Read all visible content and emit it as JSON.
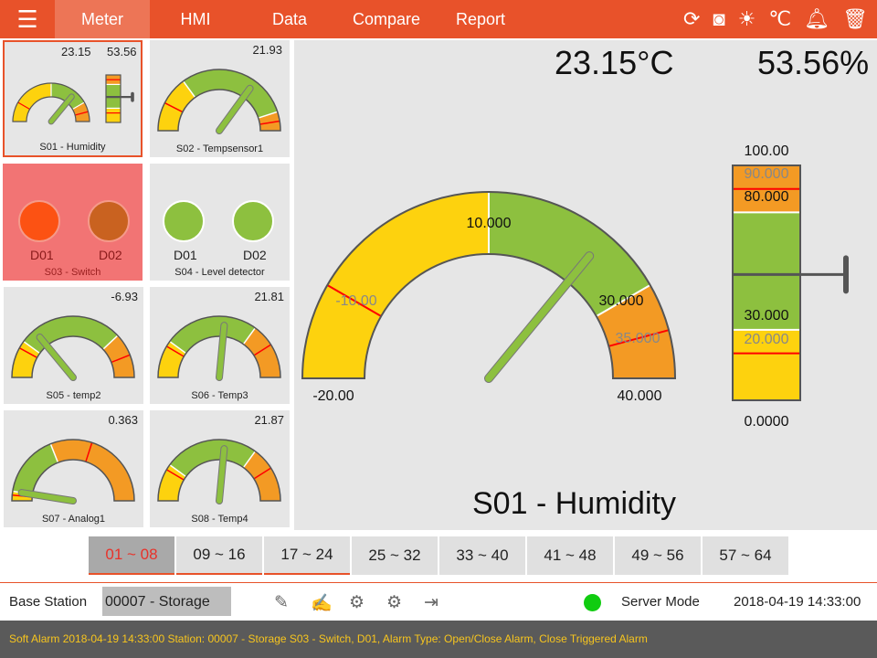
{
  "nav": {
    "tabs": [
      "Meter",
      "HMI",
      "Data",
      "Compare",
      "Report"
    ],
    "active": 0
  },
  "top_icons": [
    "sync-icon",
    "camera-icon",
    "brightness-icon",
    "celsius-icon",
    "alarm-bell-icon",
    "trash-icon"
  ],
  "colors": {
    "accent": "#E8522A",
    "yellow": "#FDD20E",
    "green": "#8DC03F",
    "orange": "#F39A24",
    "red": "#FF0000"
  },
  "tiles": [
    {
      "name": "S01 - Humidity",
      "values": [
        "23.15",
        "53.56"
      ],
      "gauge": {
        "min": -20,
        "max": 40,
        "zones": [
          10,
          30
        ],
        "reds": [
          -10,
          35
        ],
        "value": 23.15
      },
      "bar": {
        "min": 0,
        "max": 100,
        "zones": [
          30,
          80
        ],
        "reds": [
          20,
          90
        ],
        "value": 53.56
      }
    },
    {
      "name": "S02 - Tempsensor1",
      "values": [
        "21.93"
      ],
      "gauge": {
        "min": 0,
        "max": 1,
        "zones": [
          0.3,
          0.9
        ],
        "reds": [
          0.15,
          0.95
        ],
        "value": 0.7
      }
    },
    {
      "name": "S03 - Switch",
      "dots": [
        {
          "label": "D01",
          "color": "#FC5213"
        },
        {
          "label": "D02",
          "color": "#C96220"
        }
      ]
    },
    {
      "name": "S04 - Level detector",
      "dots": [
        {
          "label": "D01",
          "color": "#8DC03F"
        },
        {
          "label": "D02",
          "color": "#8DC03F"
        }
      ]
    },
    {
      "name": "S05 - temp2",
      "values": [
        "-6.93"
      ],
      "gauge": {
        "min": 0,
        "max": 1,
        "zones": [
          0.2,
          0.76
        ],
        "reds": [
          0.16,
          0.88
        ],
        "value": 0.28
      }
    },
    {
      "name": "S06 - Temp3",
      "values": [
        "21.81"
      ],
      "gauge": {
        "min": 0,
        "max": 1,
        "zones": [
          0.2,
          0.7
        ],
        "reds": [
          0.17,
          0.82
        ],
        "value": 0.53
      }
    },
    {
      "name": "S07 - Analog1",
      "values": [
        "0.363"
      ],
      "gauge": {
        "min": 0,
        "max": 1,
        "zones": [
          0.05,
          0.38
        ],
        "reds": [
          0.03,
          0.6
        ],
        "value": 0.05
      }
    },
    {
      "name": "S08 - Temp4",
      "values": [
        "21.87"
      ],
      "gauge": {
        "min": 0,
        "max": 1,
        "zones": [
          0.2,
          0.7
        ],
        "reds": [
          0.17,
          0.82
        ],
        "value": 0.53
      }
    }
  ],
  "main": {
    "title": "S01 - Humidity",
    "temperature": "23.15°C",
    "humidity": "53.56%",
    "gauge": {
      "min": -20,
      "max": 40,
      "zones": [
        10,
        30
      ],
      "reds": [
        -10,
        35
      ],
      "value": 23.15,
      "labels": {
        "min": "-20.00",
        "max": "40.000",
        "z1": "10.000",
        "z2": "30.000",
        "r1": "-10.00",
        "r2": "35.000"
      }
    },
    "bar": {
      "min": 0,
      "max": 100,
      "zones": [
        30,
        80
      ],
      "reds": [
        20,
        90
      ],
      "value": 53.56,
      "labels": {
        "max": "100.00",
        "min": "0.0000",
        "r2": "90.000",
        "z2": "80.000",
        "z1": "30.000",
        "r1": "20.000"
      }
    }
  },
  "pages": [
    "01 ~ 08",
    "09 ~ 16",
    "17 ~ 24",
    "25 ~ 32",
    "33 ~ 40",
    "41 ~ 48",
    "49 ~ 56",
    "57 ~ 64"
  ],
  "toolbar": {
    "station_label": "Base Station",
    "station_value": "00007 - Storage",
    "mode": "Server Mode",
    "datetime": "2018-04-19 14:33:00",
    "status_color": "#10CC10"
  },
  "alarm": "Soft Alarm 2018-04-19 14:33:00 Station: 00007 - Storage S03 - Switch, D01, Alarm Type: Open/Close Alarm, Close Triggered Alarm"
}
